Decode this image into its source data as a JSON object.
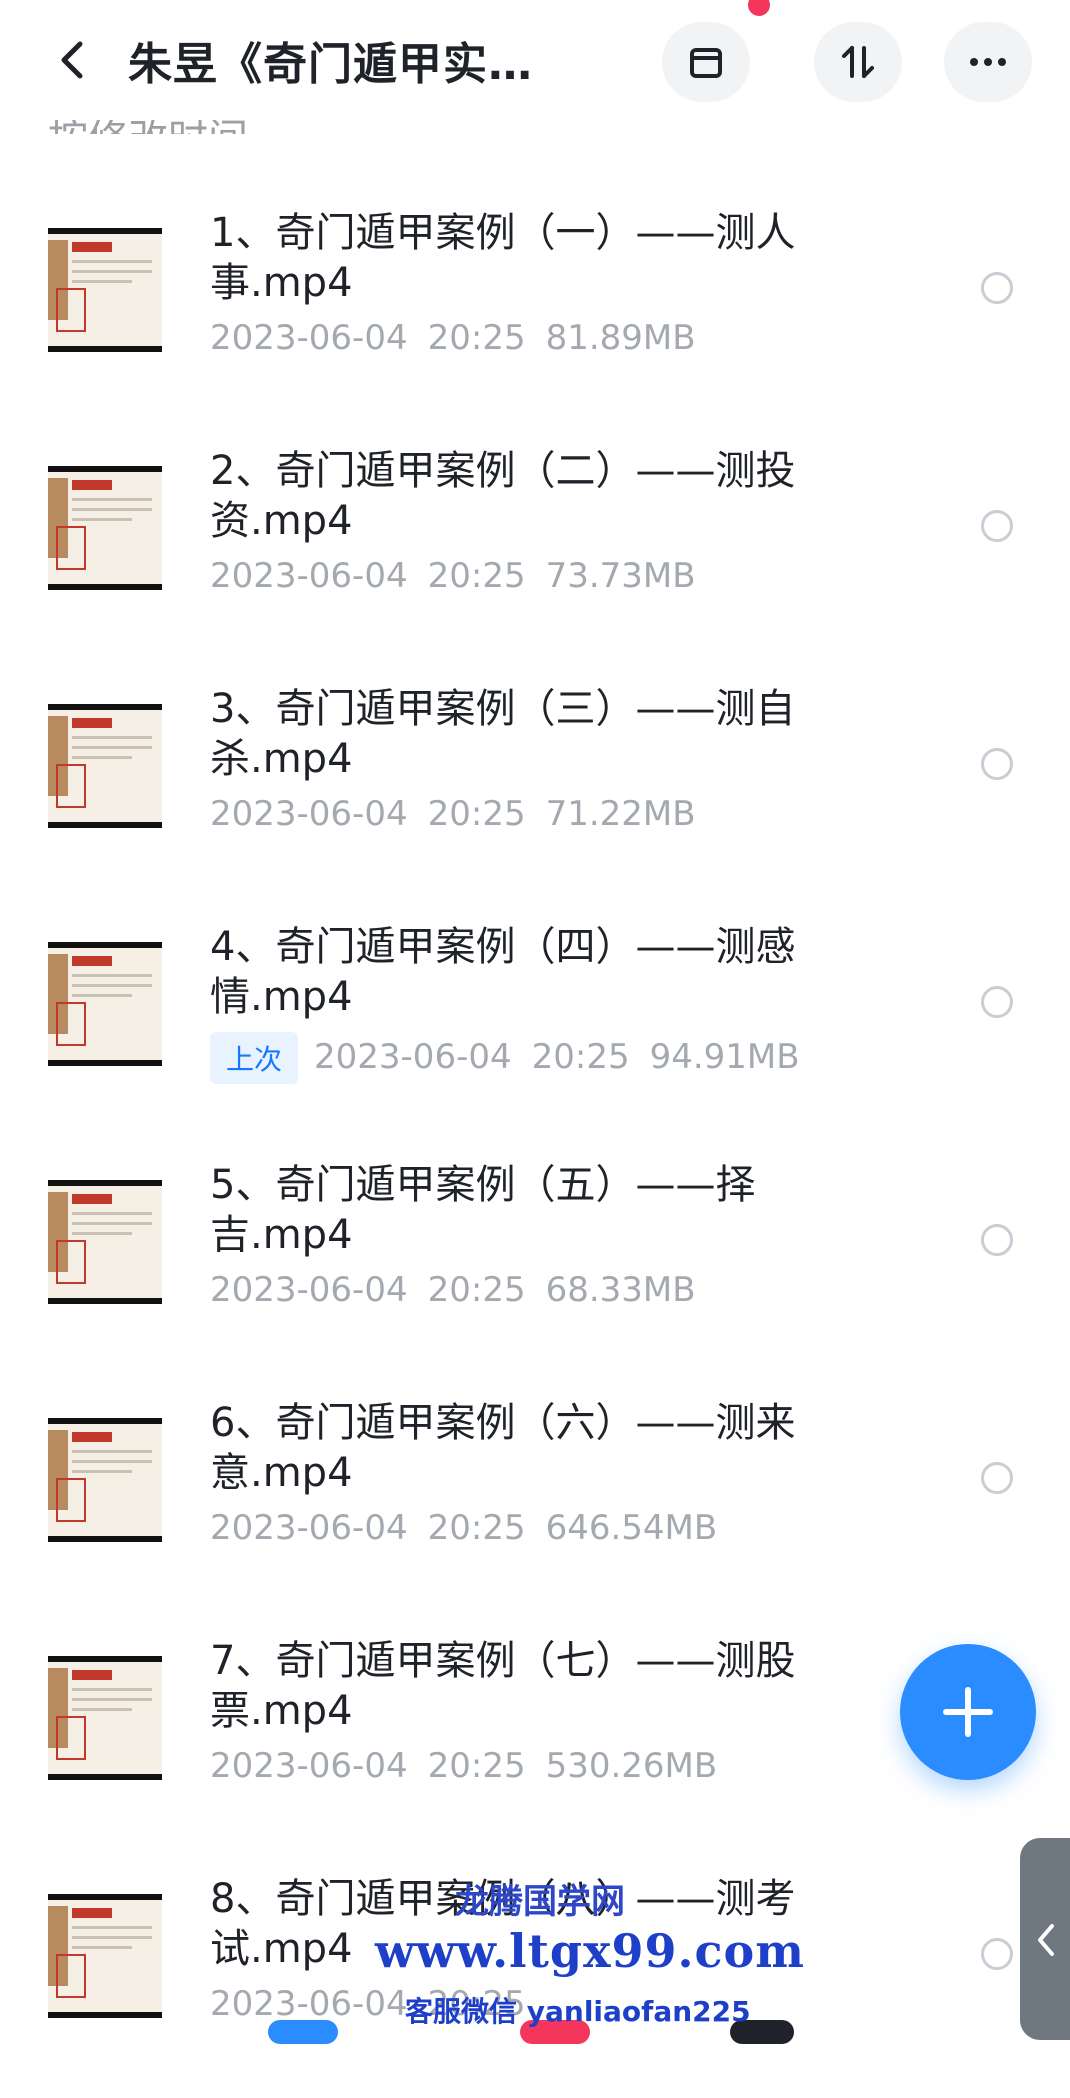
{
  "header": {
    "title": "朱昱《奇门遁甲实…"
  },
  "partial_label": "按修改时间",
  "files": [
    {
      "name": "1、奇门遁甲案例（一）——测人事.mp4",
      "date": "2023-06-04",
      "time": "20:25",
      "size": "81.89MB",
      "tag": ""
    },
    {
      "name": "2、奇门遁甲案例（二）——测投资.mp4",
      "date": "2023-06-04",
      "time": "20:25",
      "size": "73.73MB",
      "tag": ""
    },
    {
      "name": "3、奇门遁甲案例（三）——测自杀.mp4",
      "date": "2023-06-04",
      "time": "20:25",
      "size": "71.22MB",
      "tag": ""
    },
    {
      "name": "4、奇门遁甲案例（四）——测感情.mp4",
      "date": "2023-06-04",
      "time": "20:25",
      "size": "94.91MB",
      "tag": "上次"
    },
    {
      "name": "5、奇门遁甲案例（五）——择吉.mp4",
      "date": "2023-06-04",
      "time": "20:25",
      "size": "68.33MB",
      "tag": ""
    },
    {
      "name": "6、奇门遁甲案例（六）——测来意.mp4",
      "date": "2023-06-04",
      "time": "20:25",
      "size": "646.54MB",
      "tag": ""
    },
    {
      "name": "7、奇门遁甲案例（七）——测股票.mp4",
      "date": "2023-06-04",
      "time": "20:25",
      "size": "530.26MB",
      "tag": ""
    },
    {
      "name": "8、奇门遁甲案例（八）——测考试.mp4",
      "date": "2023-06-04",
      "time": "20:25",
      "size": "",
      "tag": ""
    }
  ],
  "watermark": {
    "site_name": "龙腾国学网",
    "url": "www.ltgx99.com",
    "contact": "客服微信 yanliaofan225"
  },
  "colors": {
    "accent": "#2b8cff",
    "tag_bg": "#e8f3ff",
    "tag_text": "#1677ff",
    "meta_text": "#a4a9b0",
    "notification": "#f5365c"
  },
  "icons": {
    "back": "chevron-left-icon",
    "select": "square-stack-icon",
    "sort": "sort-arrows-icon",
    "more": "more-dots-icon",
    "add": "plus-icon",
    "side": "chevron-left-icon"
  }
}
